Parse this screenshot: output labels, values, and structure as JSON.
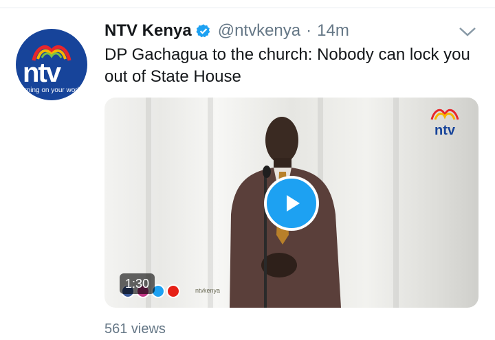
{
  "tweet": {
    "author": {
      "display_name": "NTV Kenya",
      "handle": "@ntvkenya",
      "verified": true,
      "avatar": {
        "logo_text": "ntv",
        "slogan": "turning on your world",
        "background": "#17449a"
      }
    },
    "separator": "·",
    "timestamp": "14m",
    "text": "DP Gachagua to the church: Nobody can lock you out of State House",
    "media": {
      "type": "video",
      "duration": "1:30",
      "channel_logo_text": "ntv",
      "social_handle": "ntvkenya"
    },
    "views": "561 views"
  },
  "colors": {
    "accent": "#1da1f2",
    "text_primary": "#14171a",
    "text_secondary": "#657786"
  },
  "icons": {
    "verified": "verified-badge-icon",
    "menu": "chevron-down-icon",
    "play": "play-icon"
  }
}
